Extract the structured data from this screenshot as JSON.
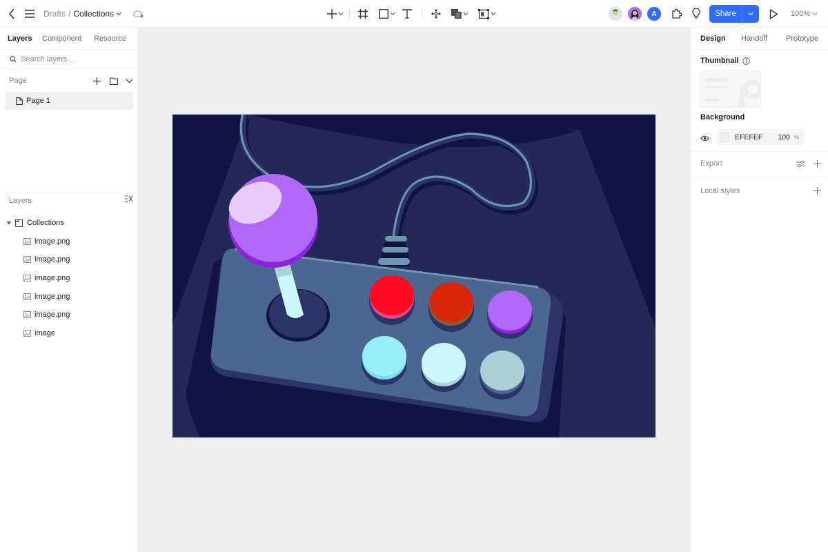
{
  "topbar": {
    "back_icon": "chevron-left-icon",
    "menu_icon": "hamburger-menu-icon",
    "breadcrumb": {
      "parent": "Drafts",
      "separator": "/",
      "current": "Collections"
    },
    "cloud_status_icon": "cloud-synced-icon",
    "tools": [
      {
        "name": "add",
        "icon": "plus-icon",
        "has_dropdown": true
      },
      {
        "name": "frame",
        "icon": "frame-icon",
        "has_dropdown": false
      },
      {
        "name": "shape",
        "icon": "rectangle-icon",
        "has_dropdown": true
      },
      {
        "name": "text",
        "icon": "text-icon",
        "has_dropdown": false
      },
      {
        "name": "component",
        "icon": "component-icon",
        "has_dropdown": false
      },
      {
        "name": "boolean",
        "icon": "boolean-icon",
        "has_dropdown": true
      },
      {
        "name": "auto-layout",
        "icon": "auto-layout-icon",
        "has_dropdown": true
      }
    ],
    "collaborators": [
      {
        "kind": "photo",
        "color": "#cdeee4"
      },
      {
        "kind": "photo",
        "color": "#a477e8"
      },
      {
        "kind": "letter",
        "letter": "A",
        "color": "#2f6bff"
      }
    ],
    "plugins_icon": "puzzle-icon",
    "idea_icon": "lightbulb-icon",
    "share_label": "Share",
    "present_icon": "play-icon",
    "zoom_level": "100%"
  },
  "left_panel": {
    "tabs": [
      "Layers",
      "Component",
      "Resource"
    ],
    "active_tab": "Layers",
    "search_placeholder": "Search layers...",
    "page_section_label": "Page",
    "pages": [
      "Page 1"
    ],
    "layers_section_label": "Layers",
    "layers": {
      "group": "Collections",
      "children": [
        "image.png",
        "image.png",
        "image.png",
        "image.png",
        "image.png",
        "image"
      ]
    }
  },
  "canvas": {
    "background": "#efefef",
    "artwork": {
      "subject": "arcade joystick controller illustration",
      "colors": {
        "bg_dark": "#0f1442",
        "bg_mid": "#232858",
        "cable": "#6d98b0",
        "body": "#4a6691",
        "body_shadow": "#2b3368",
        "ball": "#b069f7",
        "ball_shade": "#8c22dc",
        "ball_highlight": "#e7ccfb",
        "stick": "#cdf8fb",
        "buttons": [
          "#ff0a23",
          "#d82708",
          "#b069f7",
          "#97f0f9",
          "#cbf7fb",
          "#acd0d6"
        ]
      }
    }
  },
  "right_panel": {
    "tabs": [
      "Design",
      "Handoff",
      "Prototype"
    ],
    "active_tab": "Design",
    "thumbnail_label": "Thumbnail",
    "info_icon": "info-icon",
    "background_label": "Background",
    "background": {
      "visible_icon": "eye-icon",
      "hex": "EFEFEF",
      "opacity": "100",
      "unit": "%"
    },
    "export_label": "Export",
    "local_styles_label": "Local styles"
  }
}
